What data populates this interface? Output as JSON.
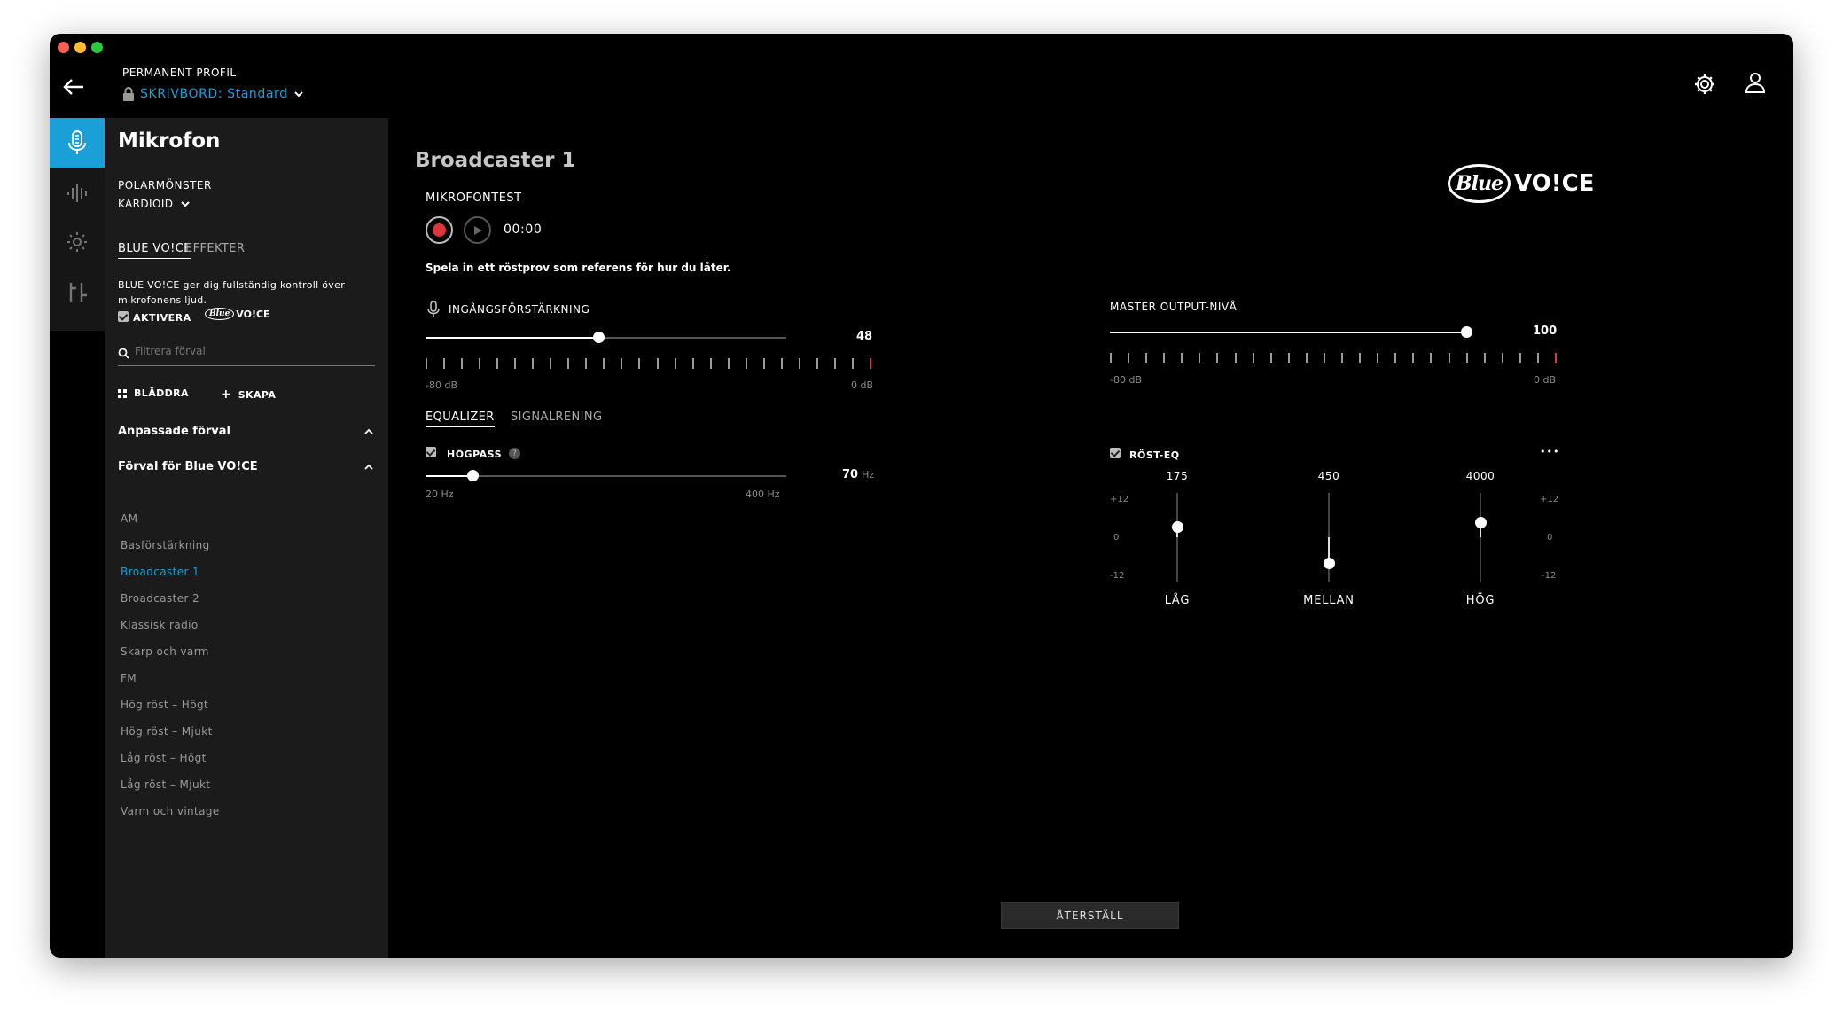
{
  "header": {
    "profile_label": "PERMANENT PROFIL",
    "profile_value": "SKRIVBORD: Standard"
  },
  "panel": {
    "title": "Mikrofon",
    "polar_label": "POLARMÖNSTER",
    "polar_value": "KARDIOID",
    "tabs": [
      "BLUE VO!CE",
      "EFFEKTER"
    ],
    "description": "BLUE VO!CE ger dig fullständig kontroll över mikrofonens ljud.",
    "activate_label": "AKTIVERA",
    "activate_logo_blue": "Blue",
    "activate_logo_voice": "VO!CE",
    "filter_placeholder": "Filtrera förval",
    "browse_label": "BLÄDDRA",
    "create_label": "SKAPA",
    "custom_presets_label": "Anpassade förval",
    "blue_presets_label": "Förval för Blue VO!CE",
    "presets": [
      "AM",
      "Basförstärkning",
      "Broadcaster 1",
      "Broadcaster 2",
      "Klassisk radio",
      "Skarp och varm",
      "FM",
      "Hög röst – Högt",
      "Hög röst – Mjukt",
      "Låg röst – Högt",
      "Låg röst – Mjukt",
      "Varm och vintage"
    ],
    "selected_preset": "Broadcaster 1"
  },
  "main": {
    "title": "Broadcaster 1",
    "mictest_label": "MIKROFONTEST",
    "timer": "00:00",
    "hint": "Spela in ett röstprov som referens för hur du låter.",
    "logo_blue": "Blue",
    "logo_voice": "VO!CE",
    "input_gain": {
      "label": "INGÅNGSFÖRSTÄRKNING",
      "value": "48",
      "min": "-80 dB",
      "max": "0 dB",
      "fraction": 0.48
    },
    "master": {
      "label": "MASTER OUTPUT-NIVÅ",
      "value": "100",
      "min": "-80 dB",
      "max": "0 dB",
      "fraction": 1.0
    },
    "tabs": [
      "EQUALIZER",
      "SIGNALRENING"
    ],
    "highpass": {
      "label": "HÖGPASS",
      "help": "?",
      "value": "70",
      "unit": "Hz",
      "min": "20 Hz",
      "max": "400 Hz",
      "fraction": 0.13
    },
    "voice_eq": {
      "label": "RÖST-EQ",
      "more": "•••",
      "scale": [
        "+12",
        "0",
        "-12"
      ],
      "bands": [
        {
          "freq": "175",
          "name": "LÅG",
          "gain_db": 3
        },
        {
          "freq": "450",
          "name": "MELLAN",
          "gain_db": -7
        },
        {
          "freq": "4000",
          "name": "HÖG",
          "gain_db": 4
        }
      ]
    },
    "reset_label": "ÅTERSTÄLL"
  },
  "colors": {
    "accent": "#1a9fd9",
    "panel_bg": "#1b1b1b",
    "window_bg": "#000000",
    "record": "#e0343b"
  }
}
